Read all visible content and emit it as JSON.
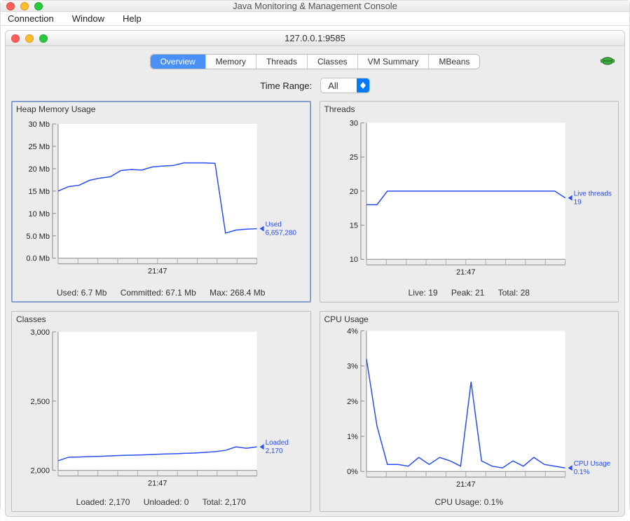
{
  "window": {
    "title": "Java Monitoring & Management Console"
  },
  "menu": {
    "items": [
      "Connection",
      "Window",
      "Help"
    ]
  },
  "inner": {
    "title": "127.0.0.1:9585"
  },
  "tabs": {
    "items": [
      "Overview",
      "Memory",
      "Threads",
      "Classes",
      "VM Summary",
      "MBeans"
    ],
    "selected_index": 0
  },
  "time_range": {
    "label": "Time Range:",
    "value": "All"
  },
  "panels": {
    "heap": {
      "title": "Heap Memory Usage",
      "annot_label": "Used",
      "annot_value": "6,657,280",
      "status": {
        "used": "Used: 6.7 Mb",
        "committed": "Committed: 67.1 Mb",
        "max": "Max: 268.4 Mb"
      }
    },
    "threads": {
      "title": "Threads",
      "annot_label": "Live threads",
      "annot_value": "19",
      "status": {
        "live": "Live: 19",
        "peak": "Peak: 21",
        "total": "Total: 28"
      }
    },
    "classes": {
      "title": "Classes",
      "annot_label": "Loaded",
      "annot_value": "2,170",
      "status": {
        "loaded": "Loaded: 2,170",
        "unloaded": "Unloaded: 0",
        "total": "Total: 2,170"
      }
    },
    "cpu": {
      "title": "CPU Usage",
      "annot_label": "CPU Usage",
      "annot_value": "0.1%",
      "status": {
        "usage": "CPU Usage: 0.1%"
      }
    }
  },
  "chart_data": [
    {
      "id": "heap",
      "type": "line",
      "title": "Heap Memory Usage",
      "xlabel": "",
      "ylabel": "",
      "ylim": [
        0,
        30
      ],
      "yticks": [
        0,
        5,
        10,
        15,
        20,
        25,
        30
      ],
      "ytick_labels": [
        "0.0 Mb",
        "5.0 Mb",
        "10 Mb",
        "15 Mb",
        "20 Mb",
        "25 Mb",
        "30 Mb"
      ],
      "xticks_label": "21:47",
      "series": [
        {
          "name": "Used",
          "values": [
            15.0,
            16.0,
            16.3,
            17.4,
            17.9,
            18.2,
            19.6,
            19.8,
            19.7,
            20.4,
            20.6,
            20.7,
            21.3,
            21.3,
            21.3,
            21.2,
            5.6,
            6.3,
            6.5,
            6.6
          ]
        }
      ],
      "annotation": {
        "label": "Used",
        "value": "6,657,280"
      }
    },
    {
      "id": "threads",
      "type": "line",
      "title": "Threads",
      "xlabel": "",
      "ylabel": "",
      "ylim": [
        10,
        30
      ],
      "yticks": [
        10,
        15,
        20,
        25,
        30
      ],
      "ytick_labels": [
        "10",
        "15",
        "20",
        "25",
        "30"
      ],
      "xticks_label": "21:47",
      "series": [
        {
          "name": "Live threads",
          "values": [
            18,
            18,
            20,
            20,
            20,
            20,
            20,
            20,
            20,
            20,
            20,
            20,
            20,
            20,
            20,
            20,
            20,
            20,
            20,
            19
          ]
        }
      ],
      "annotation": {
        "label": "Live threads",
        "value": "19"
      }
    },
    {
      "id": "classes",
      "type": "line",
      "title": "Classes",
      "xlabel": "",
      "ylabel": "",
      "ylim": [
        2000,
        3000
      ],
      "yticks": [
        2000,
        2500,
        3000
      ],
      "ytick_labels": [
        "2,000",
        "2,500",
        "3,000"
      ],
      "xticks_label": "21:47",
      "series": [
        {
          "name": "Loaded",
          "values": [
            2070,
            2095,
            2097,
            2100,
            2102,
            2105,
            2108,
            2110,
            2112,
            2115,
            2118,
            2120,
            2123,
            2125,
            2130,
            2135,
            2145,
            2170,
            2160,
            2170
          ]
        }
      ],
      "annotation": {
        "label": "Loaded",
        "value": "2,170"
      }
    },
    {
      "id": "cpu",
      "type": "line",
      "title": "CPU Usage",
      "xlabel": "",
      "ylabel": "",
      "ylim": [
        0,
        4
      ],
      "yticks": [
        0,
        1,
        2,
        3,
        4
      ],
      "ytick_labels": [
        "0%",
        "1%",
        "2%",
        "3%",
        "4%"
      ],
      "xticks_label": "21:47",
      "series": [
        {
          "name": "CPU Usage",
          "values": [
            3.2,
            1.3,
            0.2,
            0.2,
            0.15,
            0.4,
            0.2,
            0.4,
            0.3,
            0.15,
            2.55,
            0.3,
            0.15,
            0.1,
            0.3,
            0.15,
            0.4,
            0.2,
            0.15,
            0.1
          ]
        }
      ],
      "annotation": {
        "label": "CPU Usage",
        "value": "0.1%"
      }
    }
  ]
}
